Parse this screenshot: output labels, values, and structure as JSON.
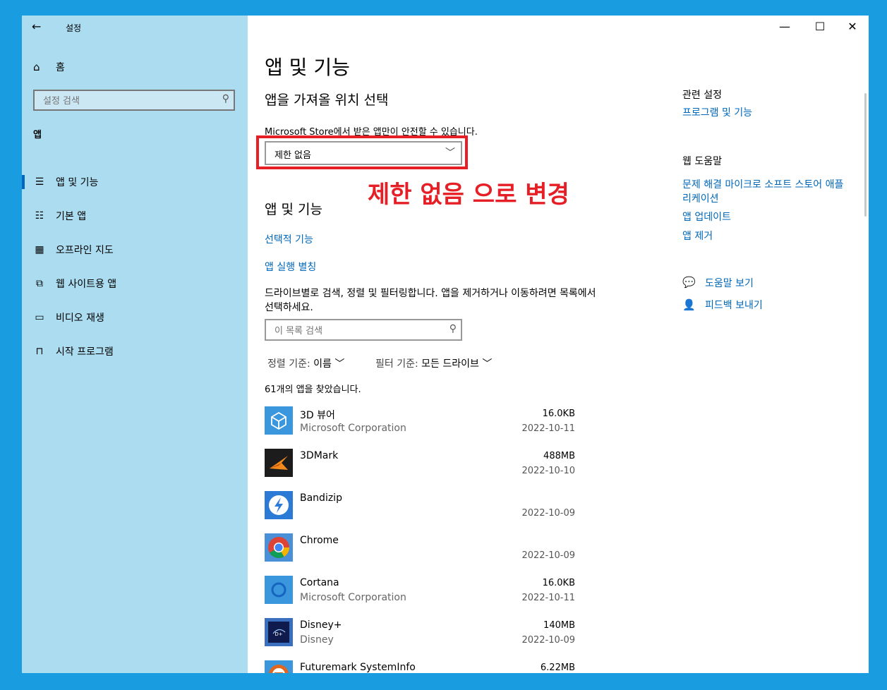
{
  "window": {
    "title": "설정",
    "back_icon": "←",
    "minimize_icon": "—",
    "maximize_icon": "☐",
    "close_icon": "✕"
  },
  "sidebar": {
    "home_label": "홈",
    "search_placeholder": "설정 검색",
    "section": "앱",
    "items": [
      {
        "label": "앱 및 기능",
        "icon": "apps-features-icon",
        "active": true
      },
      {
        "label": "기본 앱",
        "icon": "default-apps-icon",
        "active": false
      },
      {
        "label": "오프라인 지도",
        "icon": "offline-maps-icon",
        "active": false
      },
      {
        "label": "웹 사이트용 앱",
        "icon": "apps-for-websites-icon",
        "active": false
      },
      {
        "label": "비디오 재생",
        "icon": "video-playback-icon",
        "active": false
      },
      {
        "label": "시작 프로그램",
        "icon": "startup-icon",
        "active": false
      }
    ]
  },
  "main": {
    "title": "앱 및 기능",
    "install_section": {
      "title": "앱을 가져올 위치 선택",
      "description": "Microsoft Store에서 받은 앱만이 안전할 수 있습니다.",
      "dropdown_value": "제한 없음"
    },
    "annotation": "제한 없음 으로 변경",
    "apps_section": {
      "title": "앱 및 기능",
      "optional_features": "선택적 기능",
      "app_execution_aliases": "앱 실행 별칭",
      "description": "드라이브별로 검색, 정렬 및 필터링합니다. 앱을 제거하거나 이동하려면 목록에서 선택하세요.",
      "search_placeholder": "이 목록 검색",
      "sort_key": "정렬 기준:",
      "sort_value": "이름",
      "filter_key": "필터 기준:",
      "filter_value": "모든 드라이브",
      "found_text": "61개의 앱을 찾았습니다."
    },
    "apps": [
      {
        "name": "3D 뷰어",
        "publisher": "Microsoft Corporation",
        "size": "16.0KB",
        "date": "2022-10-11",
        "icon": "3d-viewer-icon",
        "color": "#3a96dd"
      },
      {
        "name": "3DMark",
        "publisher": "",
        "size": "488MB",
        "date": "2022-10-10",
        "icon": "3dmark-icon",
        "color": "#1c1c1c"
      },
      {
        "name": "Bandizip",
        "publisher": "",
        "size": "",
        "date": "2022-10-09",
        "icon": "bandizip-icon",
        "color": "#2b7bd6"
      },
      {
        "name": "Chrome",
        "publisher": "",
        "size": "",
        "date": "2022-10-09",
        "icon": "chrome-icon",
        "color": "#4a90d9"
      },
      {
        "name": "Cortana",
        "publisher": "Microsoft Corporation",
        "size": "16.0KB",
        "date": "2022-10-11",
        "icon": "cortana-icon",
        "color": "#3a96dd"
      },
      {
        "name": "Disney+",
        "publisher": "Disney",
        "size": "140MB",
        "date": "2022-10-09",
        "icon": "disney-plus-icon",
        "color": "#0f1b4c"
      },
      {
        "name": "Futuremark SystemInfo",
        "publisher": "",
        "size": "6.22MB",
        "date": "",
        "icon": "futuremark-icon",
        "color": "#e2671e"
      }
    ]
  },
  "related": {
    "heading": "관련 설정",
    "programs_link": "프로그램 및 기능",
    "web_help_heading": "웹 도움말",
    "links": [
      "문제 해결 마이크로 소프트 스토어 애플 리케이션",
      "앱 업데이트",
      "앱 제거"
    ],
    "help_label": "도움말 보기",
    "feedback_label": "피드백 보내기"
  },
  "colors": {
    "desktop": "#1a9ce0",
    "sidebar": "#abdcf0",
    "link": "#0067b8",
    "annotation": "#e61e25"
  }
}
